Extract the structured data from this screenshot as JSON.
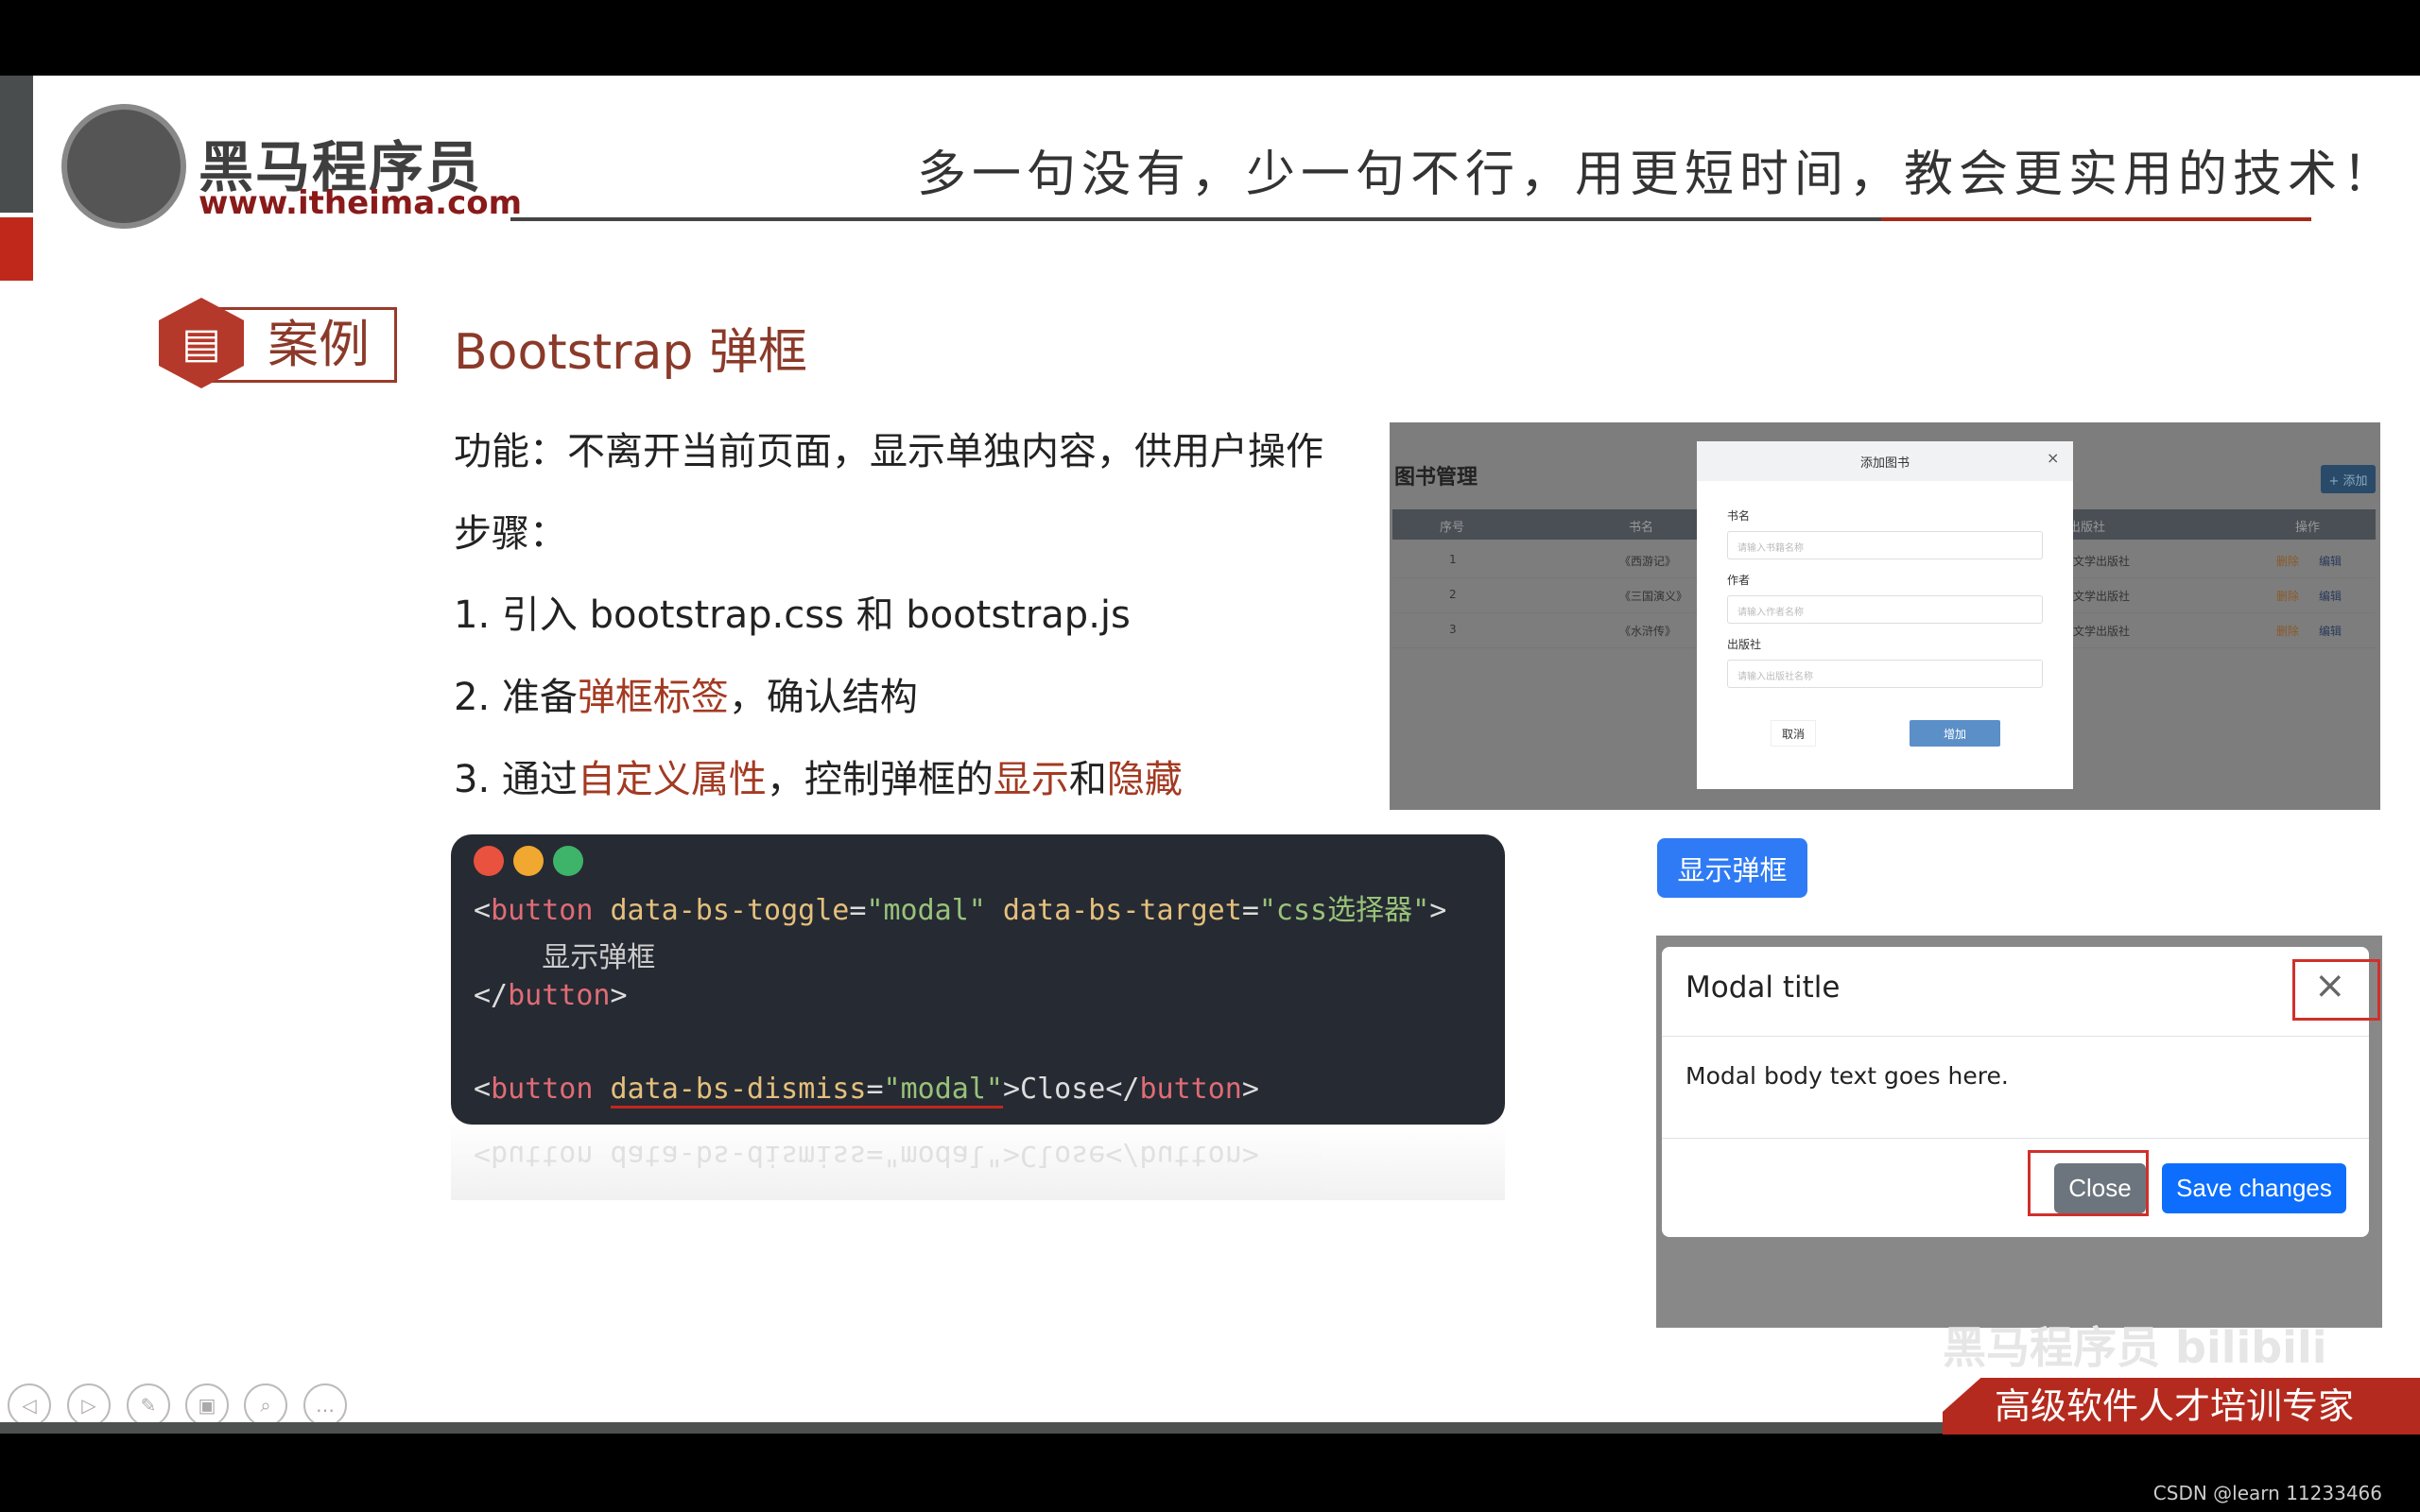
{
  "header": {
    "logo_cn": "黑马程序员",
    "logo_url": "www.itheima.com",
    "slogan": "多一句没有，少一句不行，用更短时间，教会更实用的技术！"
  },
  "section": {
    "badge": "案例",
    "title": "Bootstrap 弹框"
  },
  "content": {
    "function_line": "功能：不离开当前页面，显示单独内容，供用户操作",
    "steps_label": "步骤：",
    "step1": "1.  引入 bootstrap.css 和 bootstrap.js",
    "step2_pre": "2.  准备",
    "step2_hl": "弹框标签",
    "step2_post": "，确认结构",
    "step3_pre": "3.  通过",
    "step3_hl1": "自定义属性",
    "step3_mid": "，控制弹框的",
    "step3_hl2": "显示",
    "step3_and": "和",
    "step3_hl3": "隐藏"
  },
  "screenshot": {
    "page_title": "图书管理",
    "add_button": "+ 添加",
    "columns": [
      "序号",
      "书名",
      "出版社",
      "操作"
    ],
    "rows": [
      [
        "1",
        "《西游记》",
        "文学出版社"
      ],
      [
        "2",
        "《三国演义》",
        "文学出版社"
      ],
      [
        "3",
        "《水浒传》",
        "文学出版社"
      ]
    ],
    "row_actions": [
      "删除",
      "编辑"
    ],
    "modal": {
      "title": "添加图书",
      "close": "×",
      "fields": [
        {
          "label": "书名",
          "placeholder": "请输入书籍名称"
        },
        {
          "label": "作者",
          "placeholder": "请输入作者名称"
        },
        {
          "label": "出版社",
          "placeholder": "请输入出版社名称"
        }
      ],
      "cancel": "取消",
      "submit": "增加"
    }
  },
  "code": {
    "l1": [
      "<",
      "button",
      " data-bs-toggle",
      "=",
      "\"modal\"",
      " data-bs-target",
      "=",
      "\"css选择器\"",
      ">"
    ],
    "l2": "    显示弹框",
    "l3": [
      "</",
      "button",
      ">"
    ],
    "l4": [
      "<",
      "button",
      " data-bs-dismiss",
      "=",
      "\"modal\"",
      ">Close</",
      "button",
      ">"
    ],
    "reflection": "<button data-bs-dismiss=\"modal\">Close</button>"
  },
  "demo": {
    "show_button": "显示弹框",
    "modal_title": "Modal title",
    "close_x": "×",
    "body": "Modal body text goes here.",
    "close": "Close",
    "save": "Save changes"
  },
  "footer": {
    "banner": "高级软件人才培训专家",
    "watermark": "黑马程序员 bilibili",
    "credit": "CSDN @learn 11233466"
  },
  "colors": {
    "brand_red": "#b52a1e",
    "title_brown": "#8b3a2a",
    "primary_blue": "#2f7bf5",
    "secondary_gray": "#6c757d"
  }
}
